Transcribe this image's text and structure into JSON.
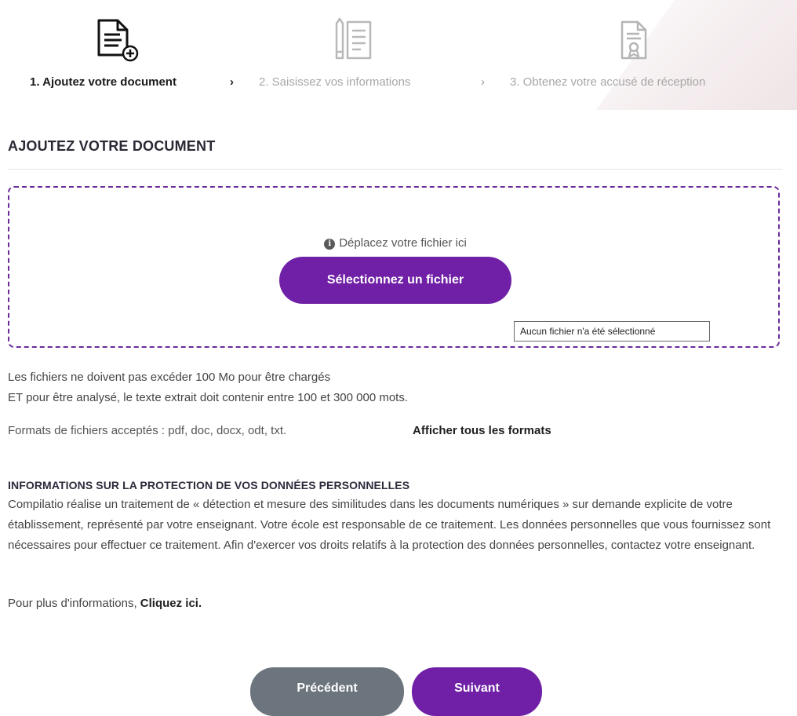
{
  "colors": {
    "accent": "#6f20a6",
    "secondary_button": "#6c757d",
    "active_step": "#1a1a1a",
    "inactive_step": "#a7a7a7"
  },
  "stepper": {
    "steps": [
      {
        "label": "1. Ajoutez votre document",
        "icon": "document-add-icon",
        "active": true
      },
      {
        "label": "2. Saisissez vos informations",
        "icon": "pencil-document-icon",
        "active": false
      },
      {
        "label": "3. Obtenez votre accusé de réception",
        "icon": "certificate-document-icon",
        "active": false
      }
    ],
    "separator": "›"
  },
  "section": {
    "title": "AJOUTEZ VOTRE DOCUMENT"
  },
  "dropzone": {
    "hint": "Déplacez votre fichier ici",
    "info_icon": "info-icon",
    "select_button": "Sélectionnez un fichier",
    "file_status": "Aucun fichier n'a été sélectionné"
  },
  "limits": {
    "line1": "Les fichiers ne doivent pas excéder 100 Mo pour être chargés",
    "line2": "ET pour être analysé, le texte extrait doit contenir entre 100 et 300 000 mots."
  },
  "formats": {
    "text": "Formats de fichiers acceptés : pdf, doc, docx, odt, txt.",
    "link": "Afficher tous les formats"
  },
  "privacy": {
    "title": "INFORMATIONS SUR LA PROTECTION DE VOS DONNÉES PERSONNELLES",
    "body": "Compilatio réalise un traitement de « détection et mesure des similitudes dans les documents numériques » sur demande explicite de votre établissement, représenté par votre enseignant. Votre école est responsable de ce traitement. Les données personnelles que vous fournissez sont nécessaires pour effectuer ce traitement. Afin d'exercer vos droits relatifs à la protection des données personnelles, contactez votre enseignant.",
    "more_prefix": "Pour plus d'informations,",
    "more_link": "Cliquez ici."
  },
  "nav": {
    "previous": "Précédent",
    "next": "Suivant"
  }
}
